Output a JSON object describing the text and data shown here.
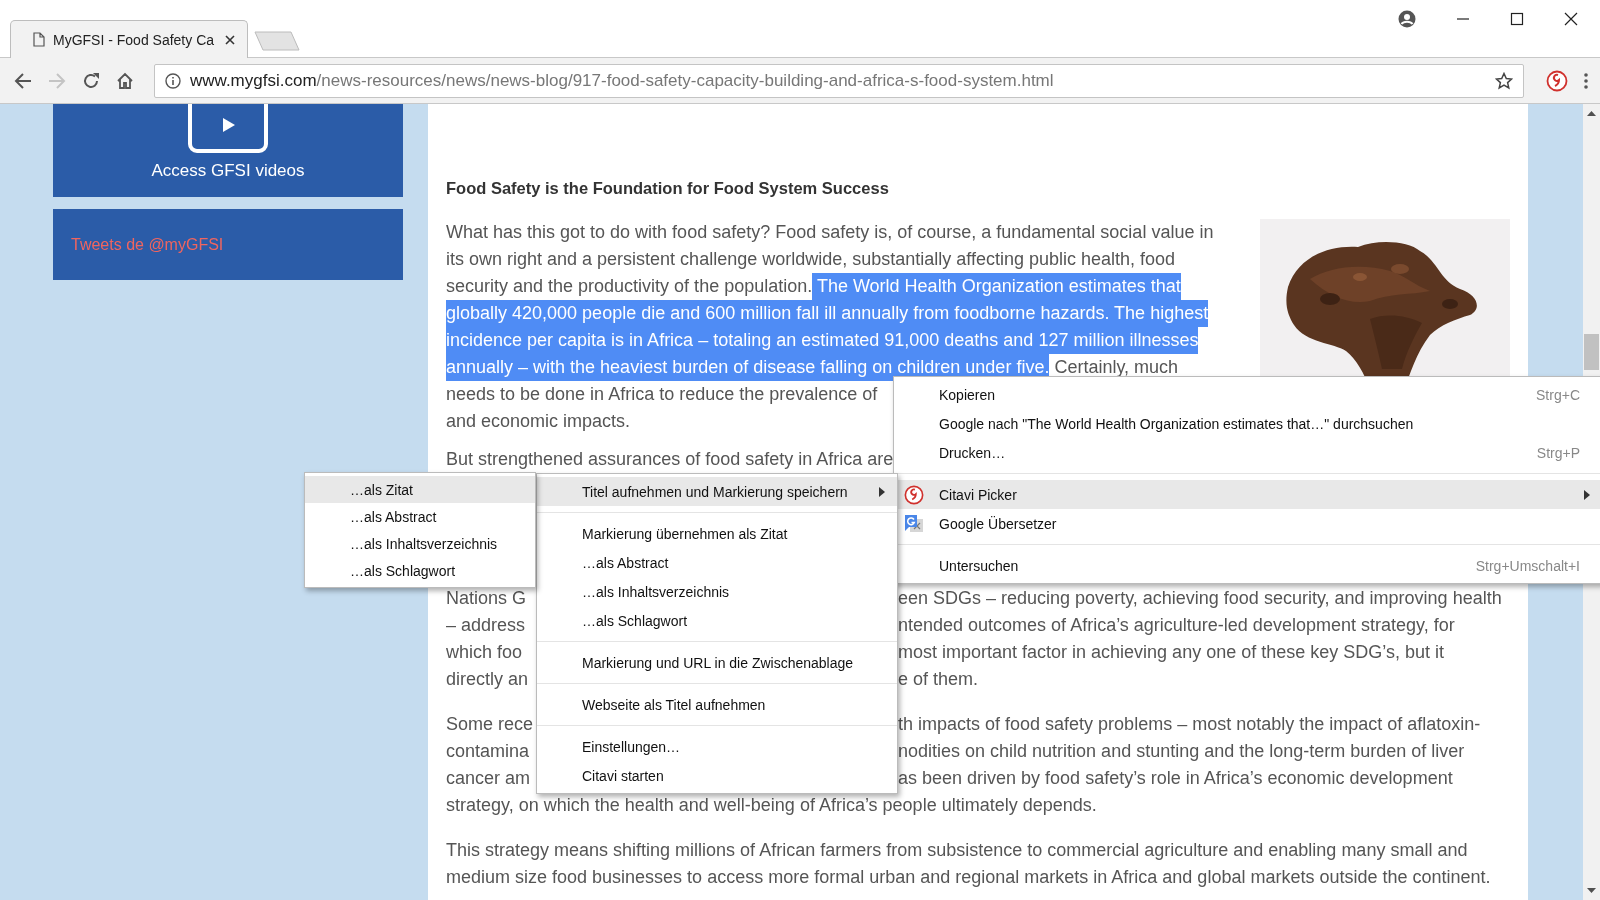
{
  "tab": {
    "title": "MyGFSI - Food Safety Ca"
  },
  "address_bar": {
    "host": "www.mygfsi.com",
    "path": "/news-resources/news/news-blog/917-food-safety-capacity-building-and-africa-s-food-system.html"
  },
  "sidebar": {
    "video_box": {
      "label": "Access GFSI videos"
    },
    "tweets_box": {
      "label": "Tweets de @myGFSI"
    }
  },
  "article": {
    "heading": "Food Safety is the Foundation for Food System Success",
    "paragraphs": [
      {
        "lines": [
          {
            "kind": "full",
            "segments": [
              {
                "text": "What has this got to do with food safety? Food safety is, of course, a fundamental social value in",
                "selected": false
              }
            ]
          },
          {
            "kind": "full",
            "segments": [
              {
                "text": "its own right and a persistent challenge worldwide, substantially affecting public health, food",
                "selected": false
              }
            ]
          },
          {
            "kind": "full",
            "segments": [
              {
                "text": "security and the productivity of the population.",
                "selected": false
              },
              {
                "text": " The World Health Organization estimates that",
                "selected": true
              }
            ]
          },
          {
            "kind": "full",
            "segments": [
              {
                "text": "globally 420,000 people die and 600 million fall ill annually from foodborne hazards. The highest",
                "selected": true
              }
            ]
          },
          {
            "kind": "full",
            "segments": [
              {
                "text": "incidence per capita is in Africa – totaling an estimated 91,000 deaths and 127 million illnesses",
                "selected": true
              }
            ]
          },
          {
            "kind": "full",
            "segments": [
              {
                "text": "annually – with the heaviest burden of disease falling on children under five.",
                "selected": true
              },
              {
                "text": " Certainly, much",
                "selected": false
              }
            ]
          },
          {
            "kind": "full",
            "segments": [
              {
                "text": "needs to be done in Africa to reduce the prevalence of",
                "selected": false
              }
            ]
          },
          {
            "kind": "full",
            "segments": [
              {
                "text": "and economic impacts.",
                "selected": false
              }
            ]
          }
        ]
      },
      {
        "lines": [
          {
            "kind": "full",
            "segments": [
              {
                "text": "But strengthened assurances of food safety in Africa are",
                "selected": false
              }
            ]
          }
        ]
      },
      {
        "lines": [
          {
            "kind": "split",
            "segments": [
              {
                "text": "Nations G",
                "selected": false
              },
              {
                "text": "een SDGs – reducing poverty, achieving food security, and improving health",
                "selected": false
              }
            ]
          },
          {
            "kind": "split",
            "segments": [
              {
                "text": "– address",
                "selected": false
              },
              {
                "text": "ntended outcomes of Africa’s agriculture-led development strategy, for",
                "selected": false
              }
            ]
          },
          {
            "kind": "split",
            "segments": [
              {
                "text": "which foo",
                "selected": false
              },
              {
                "text": "most important factor in achieving any one of these key SDG’s, but it",
                "selected": false
              }
            ]
          },
          {
            "kind": "split",
            "segments": [
              {
                "text": "directly an",
                "selected": false
              },
              {
                "text": "e of them.",
                "selected": false
              }
            ]
          }
        ]
      },
      {
        "lines": [
          {
            "kind": "split",
            "segments": [
              {
                "text": "Some rece",
                "selected": false
              },
              {
                "text": "th impacts of food safety problems – most notably the impact of aflatoxin-",
                "selected": false
              }
            ]
          },
          {
            "kind": "split",
            "segments": [
              {
                "text": "contamina",
                "selected": false
              },
              {
                "text": "nodities on child nutrition and stunting and the long-term burden of liver",
                "selected": false
              }
            ]
          },
          {
            "kind": "split",
            "segments": [
              {
                "text": "cancer am",
                "selected": false
              },
              {
                "text": "as been driven by food safety’s role in Africa’s economic development",
                "selected": false
              }
            ]
          },
          {
            "kind": "full",
            "segments": [
              {
                "text": "strategy, on which the health and well-being of Africa’s people ultimately depends.",
                "selected": false
              }
            ]
          }
        ]
      },
      {
        "lines": [
          {
            "kind": "full",
            "segments": [
              {
                "text": "This strategy means shifting millions of African farmers from subsistence to commercial agriculture and enabling many small and",
                "selected": false
              }
            ]
          },
          {
            "kind": "full",
            "segments": [
              {
                "text": "medium size food businesses to access more formal urban and regional markets in Africa and global markets outside the continent.",
                "selected": false
              }
            ]
          }
        ]
      }
    ]
  },
  "context_menu": {
    "items": [
      {
        "kind": "item",
        "label": "Kopieren",
        "shortcut": "Strg+C",
        "selected": false,
        "submenu": false
      },
      {
        "kind": "item",
        "label": "Google nach \"The World Health Organization estimates that…\" durchsuchen",
        "selected": false,
        "submenu": false
      },
      {
        "kind": "item",
        "label": "Drucken…",
        "shortcut": "Strg+P",
        "selected": false,
        "submenu": false
      },
      {
        "kind": "separator"
      },
      {
        "kind": "item",
        "label": "Citavi Picker",
        "selected": true,
        "submenu": true
      },
      {
        "kind": "item",
        "label": "Google Übersetzer",
        "selected": false,
        "submenu": false
      },
      {
        "kind": "separator"
      },
      {
        "kind": "item",
        "label": "Untersuchen",
        "shortcut": "Strg+Umschalt+I",
        "selected": false,
        "submenu": false
      }
    ]
  },
  "citavi_menu": {
    "items": [
      {
        "kind": "item",
        "label": "Titel aufnehmen und Markierung speichern",
        "selected": true,
        "submenu": true
      },
      {
        "kind": "separator"
      },
      {
        "kind": "item",
        "label": "Markierung übernehmen als Zitat",
        "selected": false,
        "submenu": false
      },
      {
        "kind": "item",
        "label": "…als Abstract",
        "selected": false,
        "submenu": false
      },
      {
        "kind": "item",
        "label": "…als Inhaltsverzeichnis",
        "selected": false,
        "submenu": false
      },
      {
        "kind": "item",
        "label": "…als Schlagwort",
        "selected": false,
        "submenu": false
      },
      {
        "kind": "separator"
      },
      {
        "kind": "item",
        "label": "Markierung und URL in die Zwischenablage",
        "selected": false,
        "submenu": false
      },
      {
        "kind": "separator"
      },
      {
        "kind": "item",
        "label": "Webseite als Titel aufnehmen",
        "selected": false,
        "submenu": false
      },
      {
        "kind": "separator"
      },
      {
        "kind": "item",
        "label": "Einstellungen…",
        "selected": false,
        "submenu": false
      },
      {
        "kind": "item",
        "label": "Citavi starten",
        "selected": false,
        "submenu": false
      }
    ]
  },
  "citavi_submenu": {
    "items": [
      {
        "kind": "item",
        "label": "…als Zitat",
        "selected": true,
        "submenu": false
      },
      {
        "kind": "item",
        "label": "…als Abstract",
        "selected": false,
        "submenu": false
      },
      {
        "kind": "item",
        "label": "…als Inhaltsverzeichnis",
        "selected": false,
        "submenu": false
      },
      {
        "kind": "item",
        "label": "…als Schlagwort",
        "selected": false,
        "submenu": false
      }
    ]
  }
}
